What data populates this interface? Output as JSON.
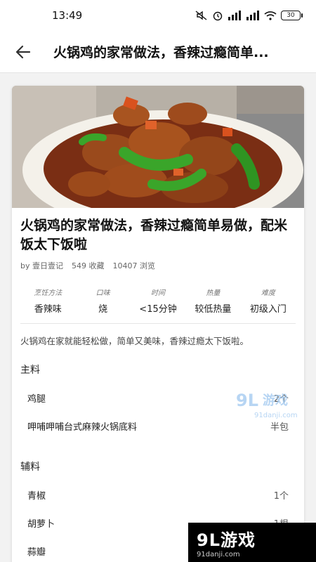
{
  "status_bar": {
    "time": "13:49",
    "battery": "30"
  },
  "app_bar": {
    "title": "火锅鸡的家常做法，香辣过瘾简单..."
  },
  "recipe": {
    "title": "火锅鸡的家常做法，香辣过瘾简单易做，配米饭太下饭啦",
    "author": "by 壹日壹记",
    "favorites": "549 收藏",
    "views": "10407 浏览",
    "description": "火锅鸡在家就能轻松做，简单又美味，香辣过瘾太下饭啦。"
  },
  "stats": [
    {
      "label": "烹饪方法",
      "value": "香辣味"
    },
    {
      "label": "口味",
      "value": "烧"
    },
    {
      "label": "时间",
      "value": "<15分钟"
    },
    {
      "label": "热量",
      "value": "较低热量"
    },
    {
      "label": "难度",
      "value": "初级入门"
    }
  ],
  "main_ingredients": {
    "title": "主料",
    "items": [
      {
        "name": "鸡腿",
        "qty": "2个"
      },
      {
        "name": "呷哺呷哺台式麻辣火锅底料",
        "qty": "半包"
      }
    ]
  },
  "aux_ingredients": {
    "title": "辅料",
    "items": [
      {
        "name": "青椒",
        "qty": "1个"
      },
      {
        "name": "胡萝卜",
        "qty": "1根"
      },
      {
        "name": "蒜瓣",
        "qty": ""
      }
    ]
  },
  "watermark": {
    "brand": "9L游戏",
    "site": "91danji.com"
  },
  "colors": {
    "accent": "#111111",
    "pepper_green": "#3aa52a",
    "chicken_brown": "#9a4a1c"
  }
}
